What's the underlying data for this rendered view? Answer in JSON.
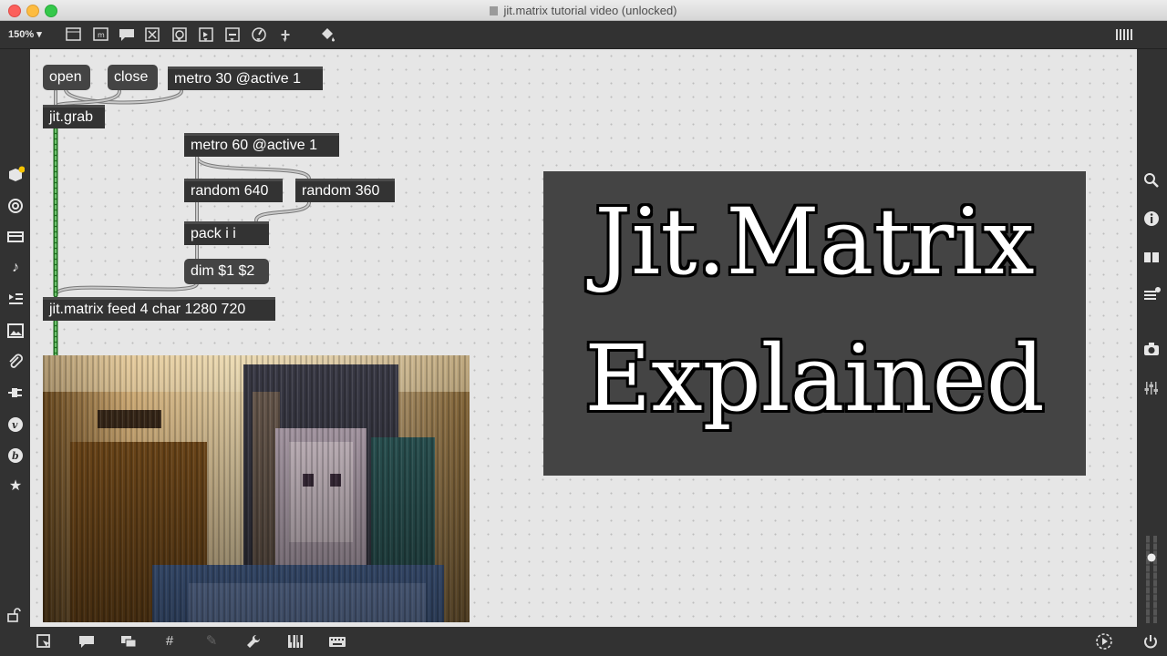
{
  "window": {
    "title": "jit.matrix tutorial video (unlocked)"
  },
  "toolbar": {
    "zoom": "150%"
  },
  "patch": {
    "messages": [
      "open",
      "close"
    ],
    "objects": {
      "metro30": "metro 30 @active 1",
      "jitgrab": "jit.grab",
      "metro60": "metro 60 @active 1",
      "random640": "random 640",
      "random360": "random 360",
      "pack": "pack i i",
      "dim": "dim $1 $2",
      "jitmatrix": "jit.matrix feed 4 char 1280 720"
    }
  },
  "title_card": {
    "line1": "Jit.Matrix",
    "line2": "Explained"
  },
  "icons": {
    "left_sidebar": [
      "package-icon",
      "target-icon",
      "media-icon",
      "music-note-icon",
      "playlist-icon",
      "image-icon",
      "paperclip-icon",
      "plug-icon",
      "vimeo-icon",
      "bpatcher-icon",
      "star-icon"
    ],
    "right_sidebar": [
      "search-icon",
      "info-icon",
      "book-icon",
      "list-icon",
      "camera-icon",
      "mixer-icon"
    ]
  }
}
